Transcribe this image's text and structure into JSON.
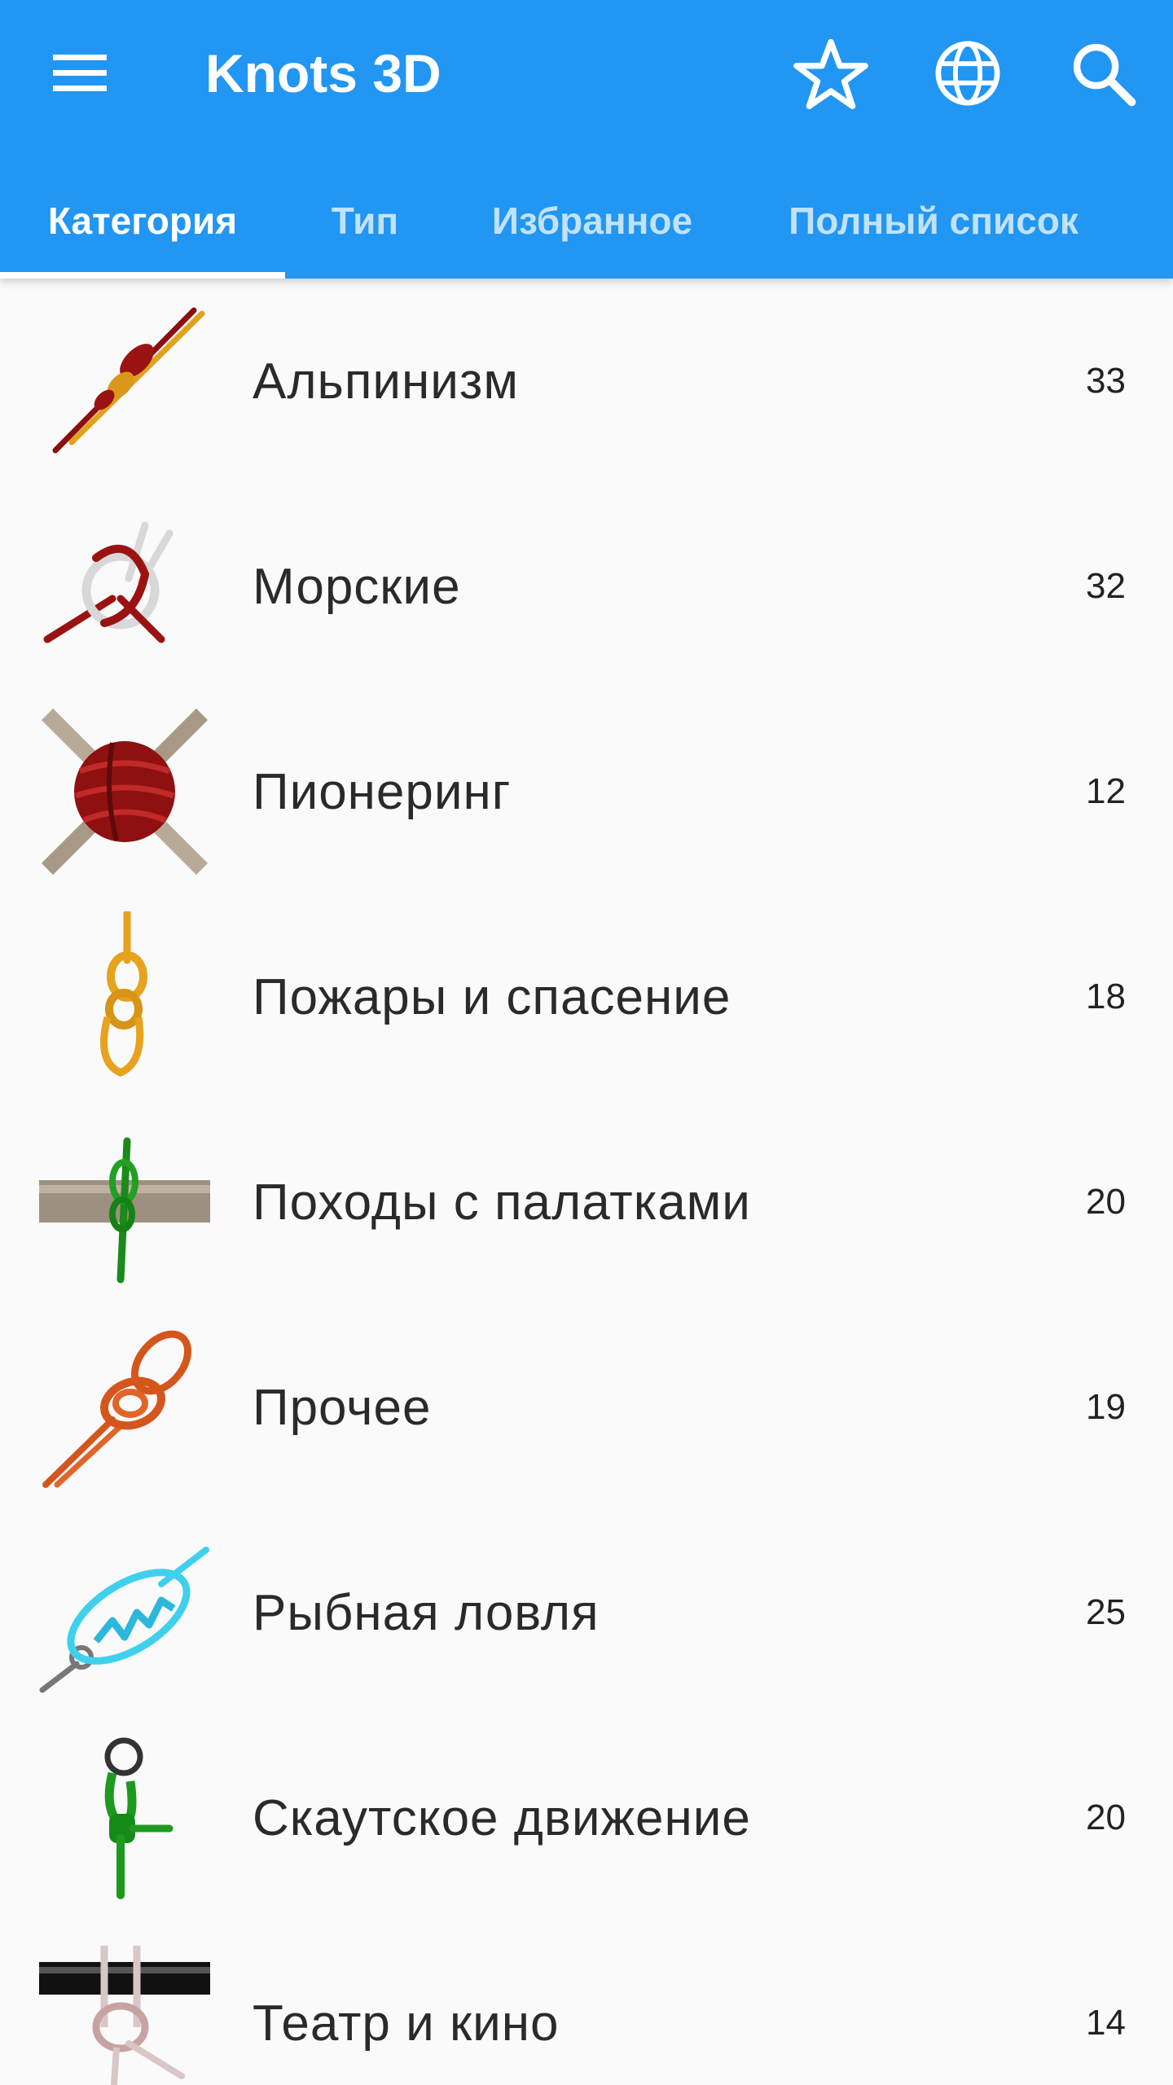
{
  "app": {
    "title": "Knots 3D",
    "colors": {
      "primary": "#2196f3",
      "on_primary": "#ffffff",
      "background": "#fafafa"
    }
  },
  "toolbar": {
    "menu_icon": "hamburger-menu-icon",
    "actions": [
      {
        "icon": "star-outline-icon"
      },
      {
        "icon": "globe-icon"
      },
      {
        "icon": "search-icon"
      }
    ]
  },
  "tabs": [
    {
      "label": "Категория",
      "active": true
    },
    {
      "label": "Тип",
      "active": false
    },
    {
      "label": "Избранное",
      "active": false
    },
    {
      "label": "Полный список",
      "active": false
    }
  ],
  "categories": [
    {
      "label": "Альпинизм",
      "count": "33",
      "icon": "climbing-knot-thumbnail"
    },
    {
      "label": "Морские",
      "count": "32",
      "icon": "boating-knot-thumbnail"
    },
    {
      "label": "Пионеринг",
      "count": "12",
      "icon": "lashing-knot-thumbnail"
    },
    {
      "label": "Пожары и спасение",
      "count": "18",
      "icon": "rescue-knot-thumbnail"
    },
    {
      "label": "Походы с палатками",
      "count": "20",
      "icon": "camping-knot-thumbnail"
    },
    {
      "label": "Прочее",
      "count": "19",
      "icon": "misc-knot-thumbnail"
    },
    {
      "label": "Рыбная ловля",
      "count": "25",
      "icon": "fishing-knot-thumbnail"
    },
    {
      "label": "Скаутское движение",
      "count": "20",
      "icon": "scouting-knot-thumbnail"
    },
    {
      "label": "Театр и кино",
      "count": "14",
      "icon": "theater-knot-thumbnail"
    }
  ]
}
